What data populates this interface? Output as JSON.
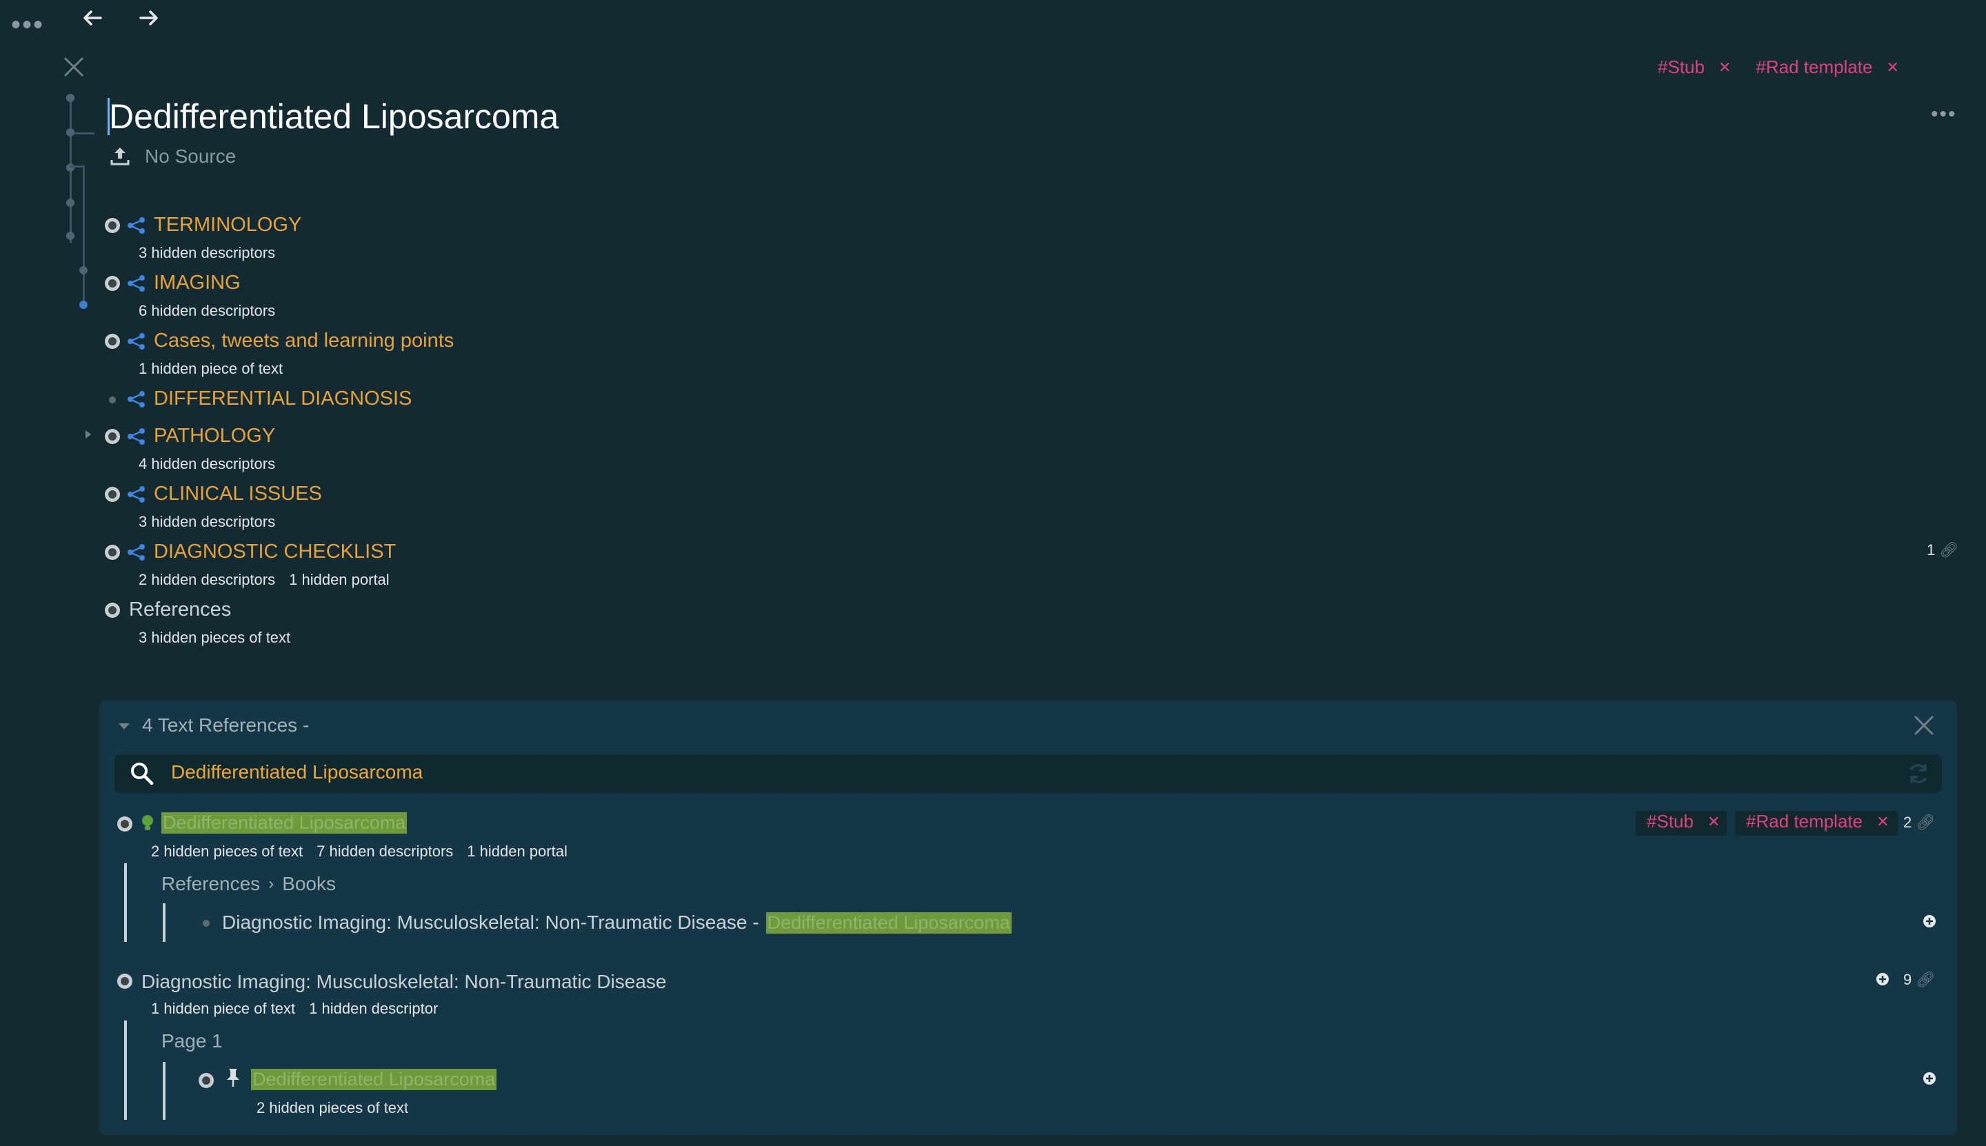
{
  "toolbar": {
    "menu_icon": "more-horizontal-icon",
    "back_icon": "arrow-left-icon",
    "forward_icon": "arrow-right-icon"
  },
  "tags": [
    "#Stub",
    "#Rad template"
  ],
  "document": {
    "title": "Dedifferentiated Liposarcoma",
    "source_label": "No Source"
  },
  "outline": [
    {
      "label": "TERMINOLOGY",
      "notes": [
        "3 hidden descriptors"
      ]
    },
    {
      "label": "IMAGING",
      "notes": [
        "6 hidden descriptors"
      ]
    },
    {
      "label": "Cases, tweets and learning points",
      "notes": [
        "1 hidden piece of text"
      ]
    },
    {
      "label": "DIFFERENTIAL DIAGNOSIS",
      "notes": []
    },
    {
      "label": "PATHOLOGY",
      "notes": [
        "4 hidden descriptors"
      ]
    },
    {
      "label": "CLINICAL ISSUES",
      "notes": [
        "3 hidden descriptors"
      ]
    },
    {
      "label": "DIAGNOSTIC CHECKLIST",
      "notes": [
        "2 hidden descriptors",
        "1 hidden portal"
      ]
    },
    {
      "label": "References",
      "notes": [
        "3 hidden pieces of text"
      ]
    }
  ],
  "checklist_count": "1",
  "references_panel": {
    "title": "4 Text References -",
    "search_value": "Dedifferentiated Liposarcoma",
    "items": [
      {
        "label": "Dedifferentiated Liposarcoma",
        "notes": [
          "2 hidden pieces of text",
          "7 hidden descriptors",
          "1 hidden portal"
        ],
        "tags": [
          "#Stub",
          "#Rad template"
        ],
        "count": "2",
        "breadcrumb": [
          "References",
          "Books"
        ],
        "child_prefix": "Diagnostic Imaging: Musculoskeletal: Non-Traumatic Disease -",
        "child_highlight": "Dedifferentiated Liposarcoma"
      },
      {
        "label": "Diagnostic Imaging: Musculoskeletal: Non-Traumatic Disease",
        "notes": [
          "1 hidden piece of text",
          "1 hidden descriptor"
        ],
        "count": "9",
        "breadcrumb": [
          "Page 1"
        ],
        "child_highlight": "Dedifferentiated Liposarcoma",
        "child_notes": [
          "2 hidden pieces of text"
        ]
      }
    ]
  }
}
